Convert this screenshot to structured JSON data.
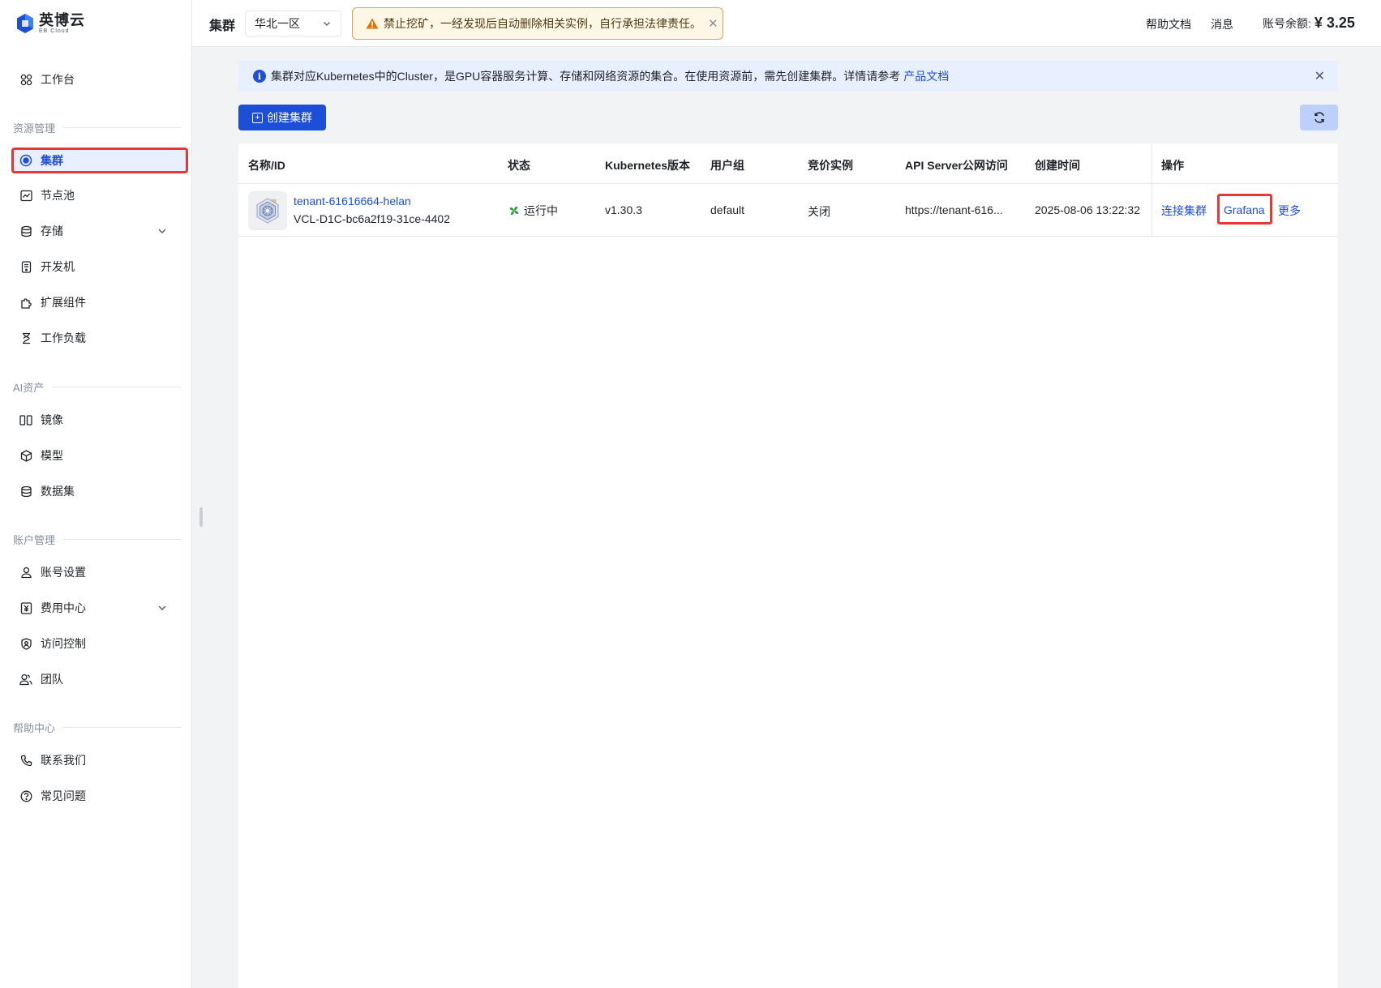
{
  "brand": {
    "name": "英博云",
    "sub": "EB Cloud"
  },
  "sidebar": {
    "workbench": "工作台",
    "sections": {
      "resource": "资源管理",
      "ai": "AI资产",
      "account": "账户管理",
      "help": "帮助中心"
    },
    "items": {
      "cluster": "集群",
      "nodepool": "节点池",
      "storage": "存储",
      "devmachine": "开发机",
      "extensions": "扩展组件",
      "workload": "工作负载",
      "image": "镜像",
      "model": "模型",
      "dataset": "数据集",
      "account_settings": "账号设置",
      "billing": "费用中心",
      "access_control": "访问控制",
      "team": "团队",
      "contact": "联系我们",
      "faq": "常见问题"
    }
  },
  "header": {
    "title": "集群",
    "region": "华北一区",
    "warning": "禁止挖矿，一经发现后自动删除相关实例，自行承担法律责任。",
    "help_docs": "帮助文档",
    "messages": "消息",
    "balance_label": "账号余额:",
    "balance_value": "¥ 3.25"
  },
  "info_banner": {
    "text": "集群对应Kubernetes中的Cluster，是GPU容器服务计算、存储和网络资源的集合。在使用资源前，需先创建集群。详情请参考",
    "link": "产品文档"
  },
  "toolbar": {
    "create": "创建集群"
  },
  "table": {
    "columns": {
      "name": "名称/ID",
      "status": "状态",
      "k8s": "Kubernetes版本",
      "group": "用户组",
      "spot": "竞价实例",
      "api": "API Server公网访问",
      "created": "创建时间",
      "ops": "操作"
    },
    "rows": [
      {
        "name": "tenant-61616664-helan",
        "id": "VCL-D1C-bc6a2f19-31ce-4402",
        "status": "运行中",
        "k8s": "v1.30.3",
        "group": "default",
        "spot": "关闭",
        "api": "https://tenant-616...",
        "created": "2025-08-06 13:22:32",
        "op_connect": "连接集群",
        "op_grafana": "Grafana",
        "op_more": "更多"
      }
    ]
  },
  "colors": {
    "primary": "#1d4ed8",
    "highlight": "#e53935",
    "warning_bg": "#fff7e6",
    "info_bg": "#e8efff",
    "running": "#2ea043"
  }
}
